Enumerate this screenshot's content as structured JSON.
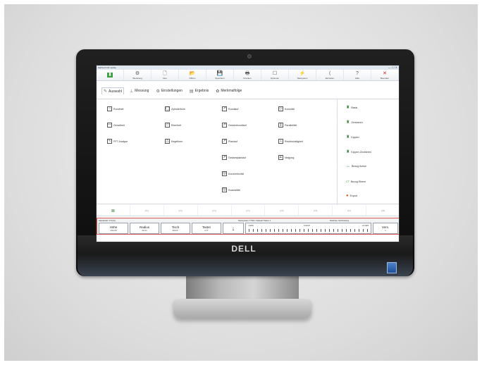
{
  "window": {
    "title": "MarSurf CM mobile",
    "controls": "— ☐ ✕"
  },
  "ribbon": [
    {
      "icon": "▮",
      "label": "",
      "name": "new"
    },
    {
      "icon": "⚙",
      "label": "Werkzeug",
      "name": "tools"
    },
    {
      "icon": "🗋",
      "label": "Neu",
      "name": "neu"
    },
    {
      "icon": "📂",
      "label": "Öffnen",
      "name": "oeffnen"
    },
    {
      "icon": "💾",
      "label": "Speichern",
      "name": "speichern"
    },
    {
      "icon": "🖶",
      "label": "Drucken",
      "name": "drucken"
    },
    {
      "icon": "☐",
      "label": "Optionen",
      "name": "optionen"
    },
    {
      "icon": "⚡",
      "label": "Tastsystem",
      "name": "tastsystem"
    },
    {
      "icon": "⟨",
      "label": "Einheiten",
      "name": "einheiten"
    },
    {
      "icon": "?",
      "label": "Hilfe",
      "name": "hilfe"
    },
    {
      "icon": "✕",
      "label": "Beenden",
      "name": "beenden"
    }
  ],
  "tabs": [
    {
      "icon": "✎",
      "label": "Auswahl"
    },
    {
      "icon": "⊥",
      "label": "Messung"
    },
    {
      "icon": "⚙",
      "label": "Einstellungen"
    },
    {
      "icon": "▤",
      "label": "Ergebnis"
    },
    {
      "icon": "✿",
      "label": "Merkmalfolge"
    }
  ],
  "features": [
    {
      "icon": "○",
      "label": "Rundheit"
    },
    {
      "icon": "—",
      "label": "Geradheit"
    },
    {
      "icon": "∿",
      "label": "FFT Analyse"
    },
    {
      "icon": "◯",
      "label": "Zylinderform"
    },
    {
      "icon": "▱",
      "label": "Ebenheit"
    },
    {
      "icon": "△",
      "label": "Kegelform"
    },
    {
      "icon": "↗",
      "label": "Rundlauf"
    },
    {
      "icon": "⇗",
      "label": "Gesamtrundlauf"
    },
    {
      "icon": "↗",
      "label": "Planlauf"
    },
    {
      "icon": "⇗",
      "label": "Gesamtplanlauf"
    },
    {
      "icon": "◎",
      "label": "Konzentrizität"
    },
    {
      "icon": "◎",
      "label": "Koaxialität"
    },
    {
      "icon": "◇",
      "label": "Konizität"
    },
    {
      "icon": "∥",
      "label": "Parallelität"
    },
    {
      "icon": "⊥",
      "label": "Rechtwinkligkeit"
    },
    {
      "icon": "∠",
      "label": "Neigung"
    }
  ],
  "right_panel": [
    {
      "icon": "♜",
      "label": "Basis"
    },
    {
      "icon": "♜",
      "label": "Zentrieren"
    },
    {
      "icon": "♜",
      "label": "Kippen"
    },
    {
      "icon": "♜",
      "label": "Kippen Zentrieren"
    },
    {
      "icon": "↔",
      "label": "Bezug Achse"
    },
    {
      "icon": "▱",
      "label": "Bezug Ebene"
    },
    {
      "icon": "●",
      "label": "Export"
    }
  ],
  "fkeys": [
    "≣",
    "[F1]",
    "[F2]",
    "[F3]",
    "[F4]",
    "[F5]",
    "[F6]",
    "[F7]",
    "[F8]"
  ],
  "status": {
    "left": "Messkraft: 0.5 [N]",
    "center": "Tastsystem T7W1: Default Taster 1",
    "right": "Nächste Verbindung",
    "cells": [
      {
        "label": "Höhe",
        "value": "100.00"
      },
      {
        "label": "Radius",
        "value": "40.21"
      },
      {
        "label": "Tisch",
        "value": "300.0°"
      },
      {
        "label": "Taster",
        "value": "0.0°"
      }
    ],
    "arrow": "↓",
    "scale_min": "-1000",
    "scale_mid": "0.0047",
    "scale_max": "+0.000",
    "vers_label": "Vers.",
    "vers_value": "1"
  },
  "brand": "DELL"
}
